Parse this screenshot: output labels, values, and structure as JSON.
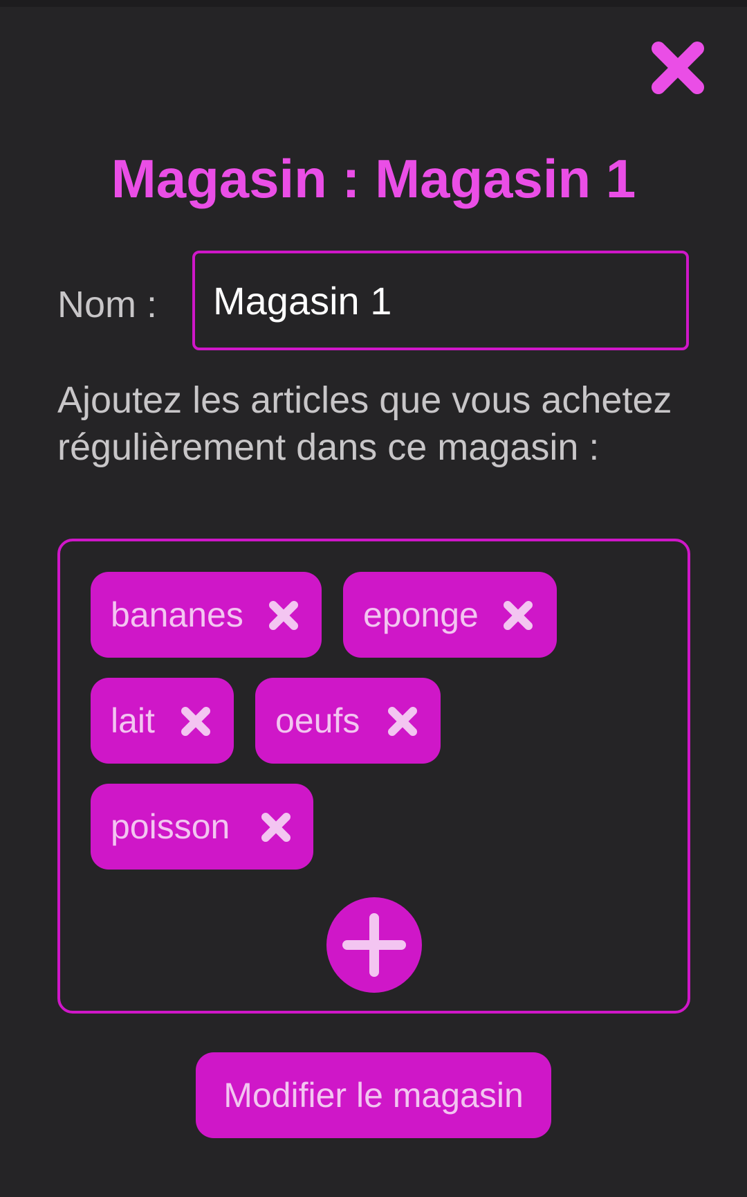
{
  "dialog": {
    "title": "Magasin : Magasin 1",
    "close_icon": "close-icon"
  },
  "form": {
    "name_label": "Nom :",
    "name_value": "Magasin 1",
    "instructions": "Ajoutez les articles que vous achetez régulièrement dans ce magasin :"
  },
  "articles": [
    {
      "label": "bananes"
    },
    {
      "label": "eponge"
    },
    {
      "label": "lait"
    },
    {
      "label": "oeufs"
    },
    {
      "label": "poisson"
    }
  ],
  "add_icon": "plus-icon",
  "submit_label": "Modifier le magasin",
  "colors": {
    "background": "#252426",
    "accent": "#cf17c8",
    "title": "#ea4ee6",
    "chip_text": "#f3c5f1",
    "label_text": "#c8c6c8"
  }
}
